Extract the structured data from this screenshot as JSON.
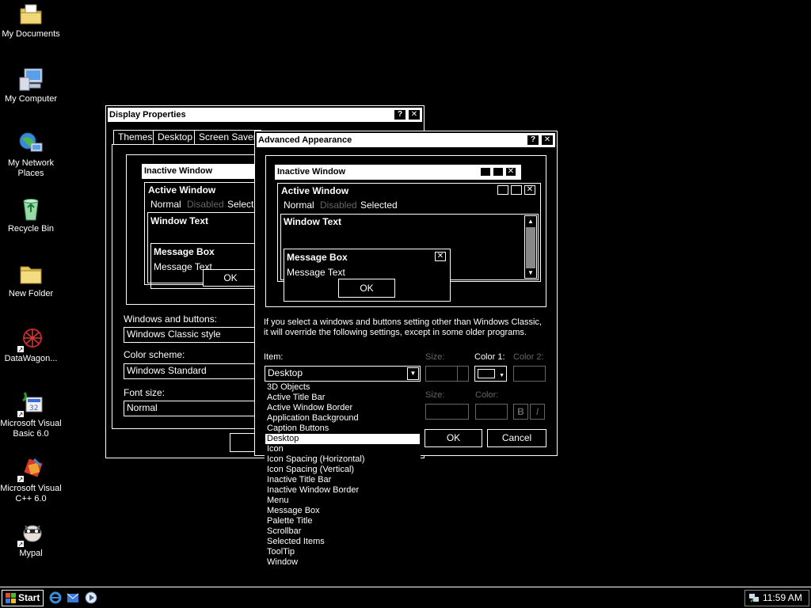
{
  "desktop": {
    "icons": [
      {
        "label_line1": "My Documents",
        "label_line2": "",
        "icon": "folder-documents-icon"
      },
      {
        "label_line1": "My Computer",
        "label_line2": "",
        "icon": "computer-icon"
      },
      {
        "label_line1": "My Network",
        "label_line2": "Places",
        "icon": "network-icon"
      },
      {
        "label_line1": "Recycle Bin",
        "label_line2": "",
        "icon": "recycle-bin-icon"
      },
      {
        "label_line1": "New Folder",
        "label_line2": "",
        "icon": "folder-icon"
      },
      {
        "label_line1": "DataWagon...",
        "label_line2": "",
        "icon": "datawagon-icon"
      },
      {
        "label_line1": "Microsoft Visual",
        "label_line2": "Basic 6.0",
        "icon": "visual-basic-icon"
      },
      {
        "label_line1": "Microsoft Visual",
        "label_line2": "C++ 6.0",
        "icon": "visual-cpp-icon"
      },
      {
        "label_line1": "Mypal",
        "label_line2": "",
        "icon": "mypal-icon"
      }
    ]
  },
  "display_properties": {
    "title": "Display Properties",
    "help_btn": "?",
    "close_btn": "✕",
    "tabs": [
      "Themes",
      "Desktop",
      "Screen Saver"
    ],
    "preview": {
      "inactive_title": "Inactive Window",
      "active_title": "Active Window",
      "menu_normal": "Normal",
      "menu_disabled": "Disabled",
      "menu_selected": "Selected",
      "window_text": "Window Text",
      "msgbox_title": "Message Box",
      "msgbox_text": "Message Text",
      "ok": "OK"
    },
    "windows_buttons_label": "Windows and buttons:",
    "windows_buttons_value": "Windows Classic style",
    "color_scheme_label": "Color scheme:",
    "color_scheme_value": "Windows Standard",
    "font_size_label": "Font size:",
    "font_size_value": "Normal"
  },
  "advanced": {
    "title": "Advanced Appearance",
    "help_btn": "?",
    "close_btn": "✕",
    "preview": {
      "inactive_title": "Inactive Window",
      "active_title": "Active Window",
      "menu_normal": "Normal",
      "menu_disabled": "Disabled",
      "menu_selected": "Selected",
      "window_text": "Window Text",
      "msgbox_title": "Message Box",
      "msgbox_text": "Message Text",
      "ok": "OK"
    },
    "info_line1": "If you select a windows and buttons setting other than Windows Classic,",
    "info_line2": "it will override the following settings, except in some older programs.",
    "item_label": "Item:",
    "item_value": "Desktop",
    "size_label": "Size:",
    "color1_label": "Color 1:",
    "color2_label": "Color 2:",
    "font_size_label": "Size:",
    "font_color_label": "Color:",
    "bold_btn": "B",
    "italic_btn": "I",
    "ok_btn": "OK",
    "cancel_btn": "Cancel",
    "items": [
      "3D Objects",
      "Active Title Bar",
      "Active Window Border",
      "Application Background",
      "Caption Buttons",
      "Desktop",
      "Icon",
      "Icon Spacing (Horizontal)",
      "Icon Spacing (Vertical)",
      "Inactive Title Bar",
      "Inactive Window Border",
      "Menu",
      "Message Box",
      "Palette Title",
      "Scrollbar",
      "Selected Items",
      "ToolTip",
      "Window"
    ],
    "selected_index": 5
  },
  "taskbar": {
    "start_label": "Start",
    "clock": "11:59 AM"
  },
  "colors": {
    "background": "#000000",
    "foreground": "#ffffff",
    "disabled": "#666666"
  }
}
